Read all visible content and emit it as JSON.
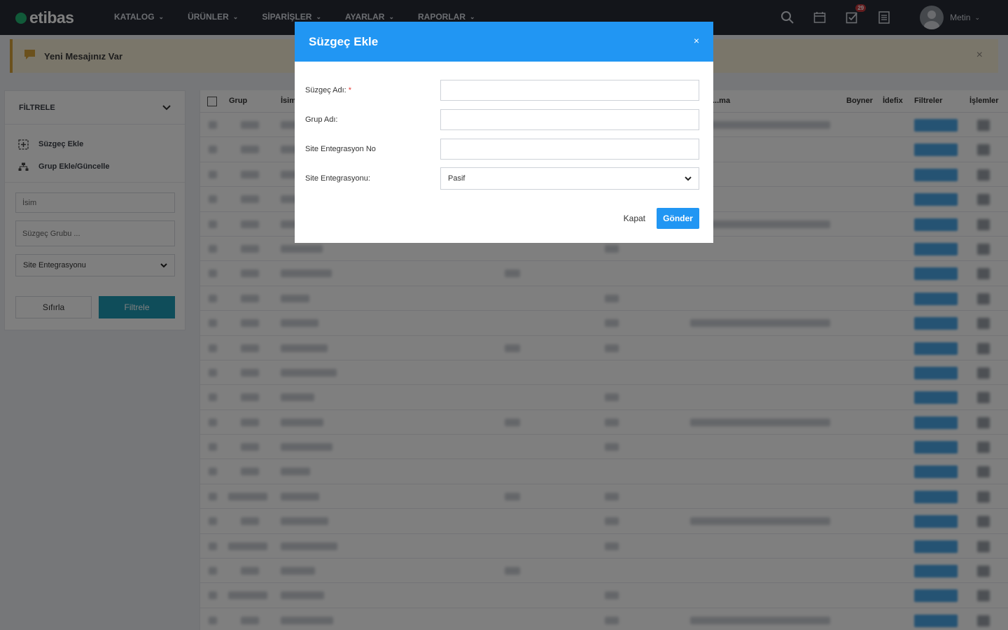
{
  "app": {
    "logo_text": "etibas",
    "accent_color": "#2196f3",
    "nav_bg": "#262b35"
  },
  "nav": {
    "menu": [
      {
        "label": "KATALOG",
        "icon": "chevron-down-icon"
      },
      {
        "label": "ÜRÜNLER",
        "icon": "chevron-down-icon"
      },
      {
        "label": "SİPARİŞLER",
        "icon": "chevron-down-icon"
      },
      {
        "label": "AYARLAR",
        "icon": "chevron-down-icon"
      },
      {
        "label": "RAPORLAR",
        "icon": "chevron-down-icon"
      }
    ],
    "tasks_badge": "29",
    "user_name": "Metin"
  },
  "alert": {
    "text": "Yeni Mesajınız Var",
    "close": "×"
  },
  "sidebar": {
    "title": "FİLTRELE",
    "links": [
      {
        "label": "Süzgeç Ekle",
        "icon": "add-square-icon"
      },
      {
        "label": "Grup Ekle/Güncelle",
        "icon": "sitemap-icon"
      }
    ],
    "name_placeholder": "İsim",
    "group_placeholder": "Süzgeç Grubu ...",
    "integration_select": "Site Entegrasyonu",
    "reset_label": "Sıfırla",
    "filter_label": "Filtrele"
  },
  "table": {
    "headers": {
      "group": "Grup",
      "name": "İsim",
      "desc": "...ma",
      "boyner": "Boyner",
      "idefix": "İdefix",
      "filters": "Filtreler",
      "actions": "İşlemler"
    },
    "row_count": 21
  },
  "modal": {
    "title": "Süzgeç Ekle",
    "close": "×",
    "fields": {
      "filter_name_label": "Süzgeç Adı:",
      "required_mark": "*",
      "group_name_label": "Grup Adı:",
      "site_integration_no_label": "Site Entegrasyon No",
      "site_integration_label": "Site Entegrasyonu:",
      "site_integration_value": "Pasif"
    },
    "close_button": "Kapat",
    "submit_button": "Gönder"
  }
}
